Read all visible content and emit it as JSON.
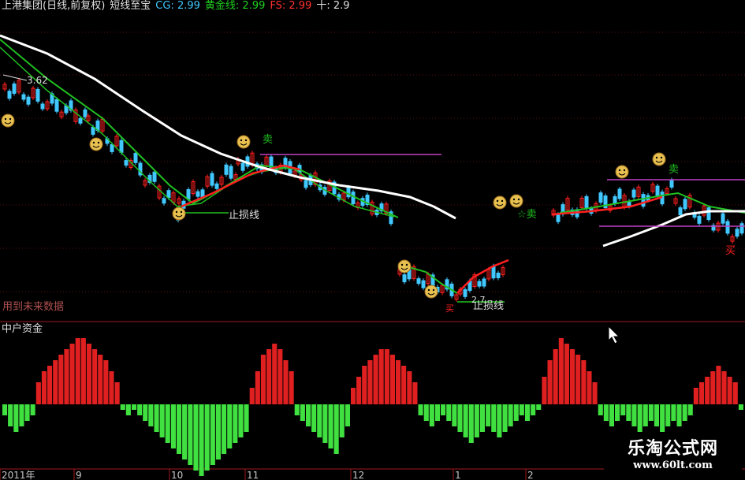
{
  "header": {
    "title": "上港集团(日线,前复权)",
    "indicator": "短线至宝",
    "cg": "CG: 2.99",
    "gold": "黄金线: 2.99",
    "fs": "FS: 2.99",
    "ten": "十: 2.9"
  },
  "colors": {
    "up": "#ff2020",
    "down": "#40c8ff",
    "green_line": "#20c020",
    "red_line": "#ff2020",
    "white_line": "#ffffff",
    "magenta": "#c040c0",
    "hist_up": "#e02020",
    "hist_down": "#40e040"
  },
  "annotations": {
    "high_price": "3.62",
    "stop_loss_1": "止损线",
    "stop_loss_2": "止损线",
    "low_price": "2.7",
    "sell_1": "卖",
    "sell_2": "☆卖",
    "sell_3": "卖",
    "buy_1": "买",
    "buy_2": "买",
    "future_data": "用到未来数据"
  },
  "sub_panel": {
    "title": "中户资金"
  },
  "x_axis": {
    "labels": [
      "2011年",
      "9",
      "10",
      "11",
      "12",
      "1",
      "2"
    ]
  },
  "watermark": {
    "name": "乐淘公式网",
    "url": "www.60lt.com"
  },
  "chart_data": [
    {
      "type": "line",
      "title": "上港集团(日线,前复权)",
      "series": [
        {
          "name": "CG",
          "last": 2.99
        },
        {
          "name": "黄金线",
          "last": 2.99
        },
        {
          "name": "FS",
          "last": 2.99
        }
      ],
      "notes": "candlestick price chart with moving-average lines; price labels 3.62 (high) and 2.7 (low)"
    },
    {
      "type": "bar",
      "title": "中户资金",
      "values": [
        -2,
        -4,
        -5,
        -4,
        -3,
        -2,
        4,
        6,
        7,
        8,
        9,
        10,
        11,
        12,
        12,
        11,
        10,
        9,
        8,
        6,
        4,
        -1,
        -2,
        -1,
        -2,
        -3,
        -4,
        -5,
        -6,
        -7,
        -8,
        -9,
        -10,
        -11,
        -12,
        -13,
        -12,
        -11,
        -10,
        -9,
        -8,
        -7,
        -6,
        -5,
        3,
        6,
        9,
        10,
        11,
        10,
        8,
        6,
        -2,
        -3,
        -4,
        -5,
        -6,
        -7,
        -8,
        -9,
        -6,
        -4,
        3,
        5,
        7,
        8,
        9,
        10,
        10,
        9,
        8,
        7,
        6,
        4,
        -2,
        -3,
        -4,
        -3,
        -2,
        -3,
        -4,
        -5,
        -6,
        -7,
        -6,
        -5,
        -4,
        -5,
        -6,
        -5,
        -4,
        -3,
        -2,
        -3,
        -2,
        -1,
        5,
        8,
        10,
        12,
        11,
        10,
        9,
        8,
        6,
        4,
        -2,
        -3,
        -4,
        -3,
        -2,
        -3,
        -4,
        -5,
        -4,
        -3,
        -4,
        -5,
        -4,
        -3,
        -4,
        -3,
        -2,
        3,
        4,
        5,
        6,
        7,
        6,
        5,
        4,
        -1
      ]
    }
  ]
}
